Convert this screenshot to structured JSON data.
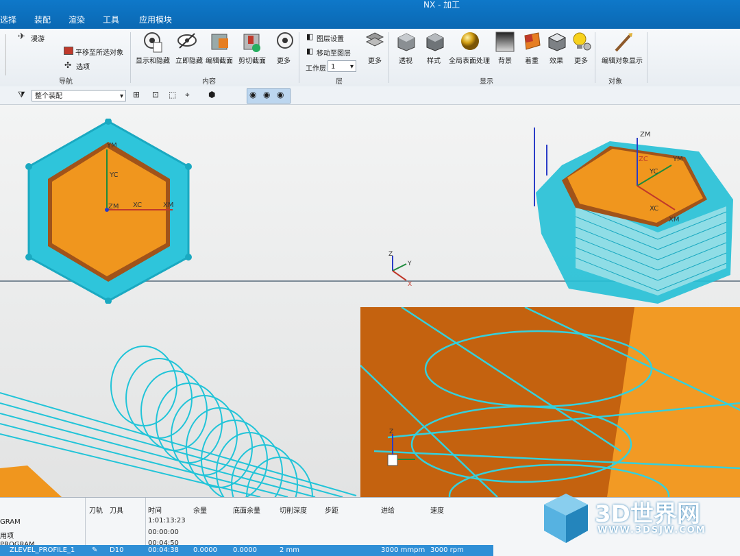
{
  "app": {
    "title": "NX - 加工"
  },
  "menu": {
    "items": [
      "选择",
      "装配",
      "渲染",
      "工具",
      "应用模块"
    ]
  },
  "ribbon": {
    "nav_items": [
      "漫游",
      "平移至所选对象",
      "选项"
    ],
    "buttons": {
      "show_hide": "显示和隐藏",
      "instant_hide": "立即隐藏",
      "edit_section": "编辑截面",
      "clip_section": "剪切截面",
      "more1": "更多",
      "layer_settings": "图层设置",
      "move_to_layer": "移动至图层",
      "work_layer_label": "工作层",
      "work_layer_value": "1",
      "more2": "更多",
      "perspective": "透视",
      "style": "样式",
      "global_shading": "全局表面处理",
      "background": "背景",
      "lighting": "着重",
      "effects": "效果",
      "more3": "更多",
      "edit_object_display": "编辑对象显示"
    },
    "groups": {
      "navigation": "导航",
      "content": "内容",
      "layer": "层",
      "display": "显示",
      "object": "对象"
    }
  },
  "toolbar2": {
    "filter_value": "整个装配"
  },
  "graphics": {
    "left_part": {
      "labels": [
        "YM",
        "YC",
        "ZM",
        "XC",
        "XM"
      ]
    },
    "right_part": {
      "labels": [
        "ZM",
        "ZC",
        "YC",
        "YM",
        "XC",
        "XM"
      ]
    },
    "triad": {
      "labels": [
        "Z",
        "Y",
        "X"
      ]
    },
    "zoom_triad": {
      "label": "Z"
    }
  },
  "navigator": {
    "headers": [
      "刀轨",
      "刀具",
      "时间",
      "余量",
      "底面余量",
      "切削深度",
      "步距",
      "进给",
      "速度"
    ],
    "rows": [
      {
        "name": "GRAM",
        "time": "1:01:13:23"
      },
      {
        "name": "用项",
        "time": "00:00:00"
      },
      {
        "name": "PROGRAM",
        "time": "00:04:50"
      },
      {
        "name": "ZLEVEL_PROFILE_1",
        "tool": "D10",
        "time": "00:04:38",
        "stock": "0.0000",
        "floor_stock": "0.0000",
        "depth": "2 mm",
        "feed": "3000 mmpm",
        "speed": "3000 rpm"
      }
    ]
  },
  "watermark": {
    "logo_text": "3D世界网",
    "url": "WWW.3DSJW.COM"
  },
  "colors": {
    "titlebar": "#0a6fc0",
    "part_orange": "#f0961e",
    "part_dark": "#b35a12",
    "toolpath_cyan": "#21c4d8",
    "selection_row": "#2f8fd6"
  }
}
